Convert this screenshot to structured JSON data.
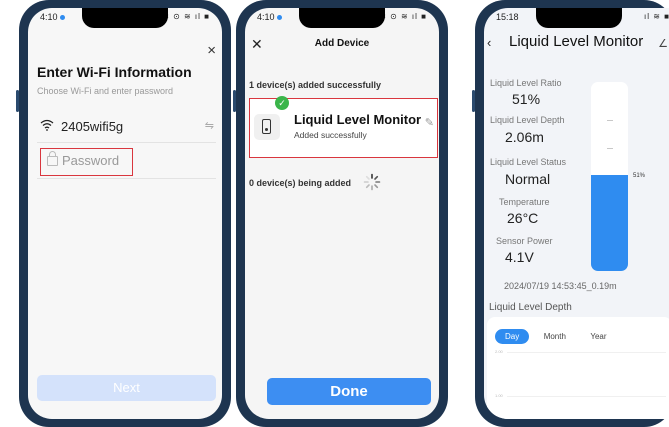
{
  "phone1": {
    "time": "4:10",
    "status_icons": "✽ ⊙ ≋ ıl ■",
    "close_symbol": "×",
    "title": "Enter Wi-Fi Information",
    "subtitle": "Choose Wi-Fi and enter password",
    "ssid": "2405wifi5g",
    "password_placeholder": "Password",
    "next_label": "Next",
    "icons": {
      "wifi": "wifi-icon",
      "swap": "swap-icon",
      "lock": "lock-icon"
    }
  },
  "phone2": {
    "time": "4:10",
    "status_icons": "✽ ⊙ ≋ ıl ■",
    "title": "Add Device",
    "added_count_text": "1 device(s) added successfully",
    "device_name": "Liquid Level Monitor",
    "device_status": "Added successfully",
    "adding_text": "0 device(s) being added",
    "done_label": "Done"
  },
  "phone3": {
    "time": "15:18",
    "status_icons": "ıl ≋ ■",
    "title": "Liquid Level Monitor",
    "metrics": [
      {
        "label": "Liquid Level Ratio",
        "value": "51%"
      },
      {
        "label": "Liquid Level Depth",
        "value": "2.06m"
      },
      {
        "label": "Liquid Level Status",
        "value": "Normal"
      },
      {
        "label": "Temperature",
        "value": "26°C"
      },
      {
        "label": "Sensor Power",
        "value": "4.1V"
      }
    ],
    "tank_level": 0.51,
    "tank_label": "51%",
    "timestamp": "2024/07/19 14:53:45_0.19m",
    "chart_title": "Liquid Level Depth",
    "tabs": [
      "Day",
      "Month",
      "Year"
    ],
    "active_tab": "Day",
    "axis_labels": [
      "2.00",
      "1.00"
    ]
  },
  "colors": {
    "accent": "#2f8cf0",
    "highlight_border": "#d9363e",
    "success": "#3ab54a",
    "phone_frame": "#1e3550",
    "next_disabled": "#d4e2fb",
    "done_button": "#3d8ef2"
  }
}
